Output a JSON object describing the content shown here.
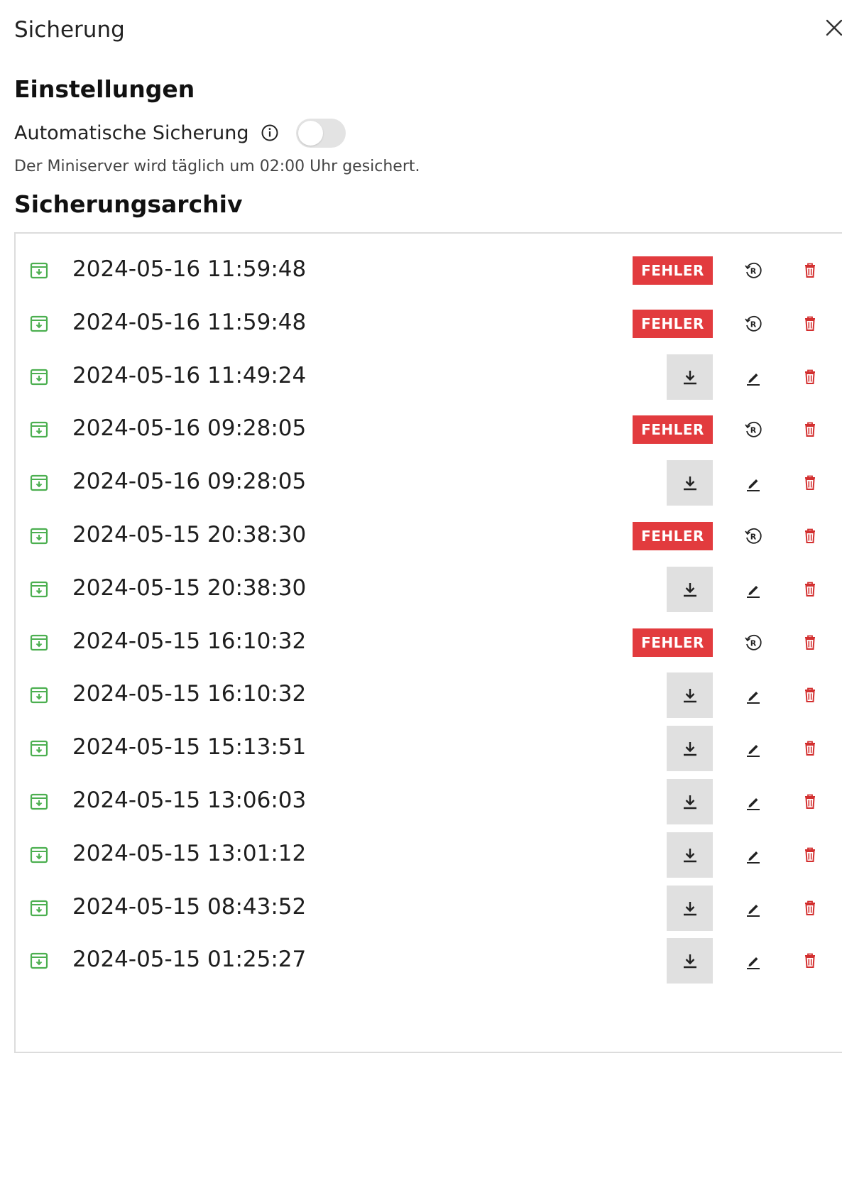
{
  "dialog": {
    "title": "Sicherung"
  },
  "settings": {
    "heading": "Einstellungen",
    "auto_backup_label": "Automatische Sicherung",
    "auto_backup_enabled": false,
    "description": "Der Miniserver wird täglich um 02:00 Uhr gesichert."
  },
  "archive": {
    "heading": "Sicherungsarchiv",
    "error_label": "FEHLER",
    "colors": {
      "error": "#e23b3e",
      "backup_icon": "#4caf50",
      "trash": "#d32f2f",
      "download_bg": "#e0e0e0"
    },
    "rows": [
      {
        "date": "2024-05-16 11:59:48",
        "status": "error"
      },
      {
        "date": "2024-05-16 11:59:48",
        "status": "error"
      },
      {
        "date": "2024-05-16 11:49:24",
        "status": "ok"
      },
      {
        "date": "2024-05-16 09:28:05",
        "status": "error"
      },
      {
        "date": "2024-05-16 09:28:05",
        "status": "ok"
      },
      {
        "date": "2024-05-15 20:38:30",
        "status": "error"
      },
      {
        "date": "2024-05-15 20:38:30",
        "status": "ok"
      },
      {
        "date": "2024-05-15 16:10:32",
        "status": "error"
      },
      {
        "date": "2024-05-15 16:10:32",
        "status": "ok"
      },
      {
        "date": "2024-05-15 15:13:51",
        "status": "ok"
      },
      {
        "date": "2024-05-15 13:06:03",
        "status": "ok"
      },
      {
        "date": "2024-05-15 13:01:12",
        "status": "ok"
      },
      {
        "date": "2024-05-15 08:43:52",
        "status": "ok"
      },
      {
        "date": "2024-05-15 01:25:27",
        "status": "ok"
      }
    ]
  }
}
